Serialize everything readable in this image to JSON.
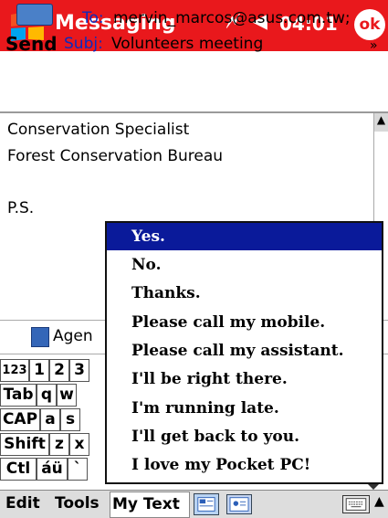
{
  "titlebar": {
    "app_title": "Messaging",
    "time": "04:01",
    "ok_label": "ok",
    "signal_icon": "signal-icon",
    "volume_icon": "speaker-icon",
    "colors": {
      "bar": "#e9181c",
      "text": "#ffffff"
    }
  },
  "header": {
    "send_label": "Send",
    "to_label": "To:",
    "to_value": "mervin_marcos@asus.com.tw;",
    "subj_label": "Subj:",
    "subj_value": "Volunteers meeting"
  },
  "body": {
    "lines": [
      "Conservation Specialist",
      "Forest Conservation Bureau",
      "P.S."
    ]
  },
  "attachment": {
    "label": "Agen"
  },
  "keyboard": {
    "row1": [
      "123",
      "1",
      "2",
      "3"
    ],
    "row2": [
      "Tab",
      "q",
      "w"
    ],
    "row3": [
      "CAP",
      "a",
      "s"
    ],
    "row4": [
      "Shift",
      "z",
      "x"
    ],
    "row5": [
      "Ctl",
      "áü",
      "`"
    ]
  },
  "menu": {
    "items": [
      "Yes.",
      "No.",
      "Thanks.",
      "Please call my mobile.",
      "Please call my assistant.",
      "I'll be right there.",
      "I'm running late.",
      "I'll get back to you.",
      "I love my Pocket PC!"
    ],
    "selected_index": 0,
    "highlight_color": "#0a1a9a"
  },
  "commandbar": {
    "edit_label": "Edit",
    "tools_label": "Tools",
    "mytext_label": "My Text"
  }
}
